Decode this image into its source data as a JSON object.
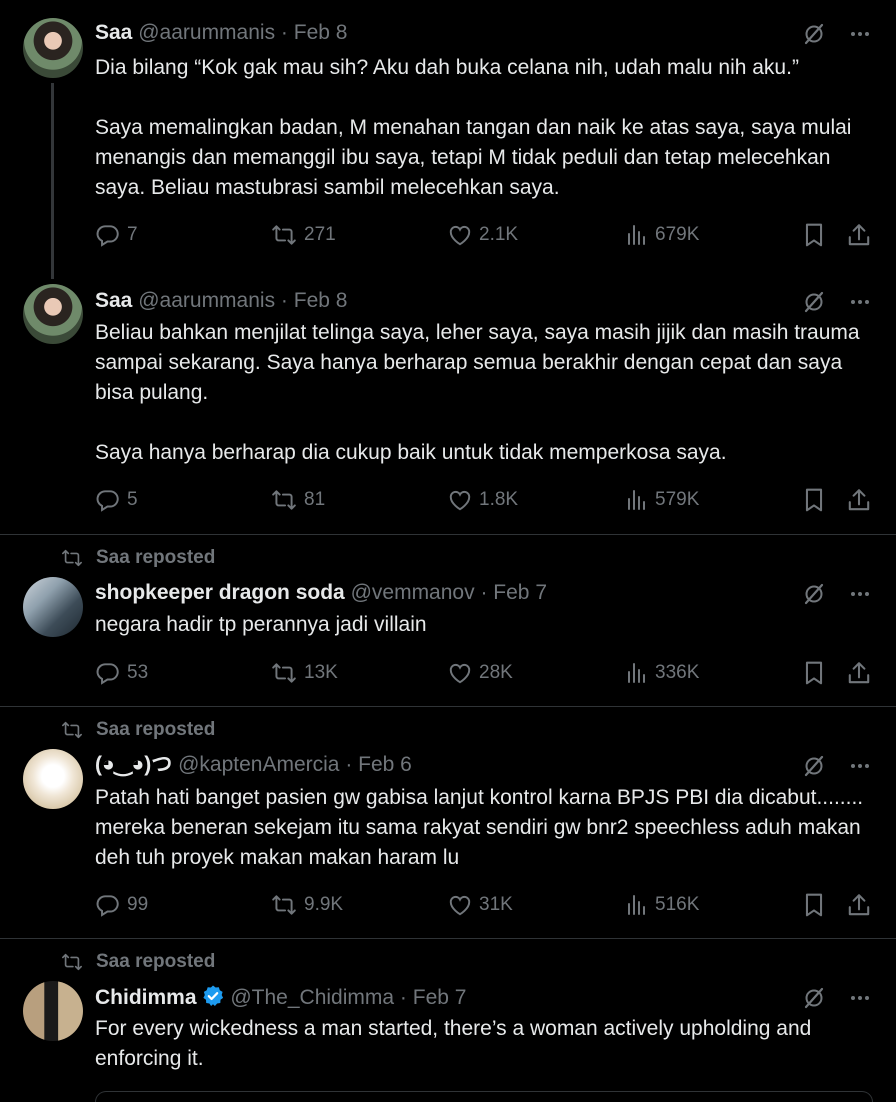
{
  "tweets": [
    {
      "reposted_by": "",
      "name": "Saa",
      "handle": "@aarummanis",
      "date": "Feb 8",
      "text": "Dia bilang “Kok gak mau sih? Aku dah buka celana nih, udah malu nih aku.”\n\nSaya memalingkan badan, M menahan tangan dan naik ke atas saya, saya mulai menangis dan memanggil ibu saya, tetapi M tidak peduli dan tetap melecehkan saya.  Beliau mastubrasi sambil melecehkan saya.",
      "replies": "7",
      "reposts": "271",
      "likes": "2.1K",
      "views": "679K"
    },
    {
      "reposted_by": "",
      "name": "Saa",
      "handle": "@aarummanis",
      "date": "Feb 8",
      "text": "Beliau bahkan menjilat telinga saya, leher saya, saya masih jijik dan masih trauma sampai sekarang. Saya hanya berharap semua berakhir dengan cepat dan saya bisa pulang.\n\nSaya hanya berharap dia cukup baik untuk tidak memperkosa saya.",
      "replies": "5",
      "reposts": "81",
      "likes": "1.8K",
      "views": "579K"
    },
    {
      "reposted_by": "Saa reposted",
      "name": "shopkeeper dragon soda",
      "handle": "@vemmanov",
      "date": "Feb 7",
      "text": "negara hadir tp perannya jadi villain",
      "replies": "53",
      "reposts": "13K",
      "likes": "28K",
      "views": "336K"
    },
    {
      "reposted_by": "Saa reposted",
      "name": "(◕‿◕)つ",
      "handle": "@kaptenAmercia",
      "date": "Feb 6",
      "text": "Patah hati banget pasien gw gabisa lanjut kontrol karna BPJS PBI dia dicabut........ mereka beneran sekejam itu sama rakyat sendiri gw bnr2 speechless aduh makan deh tuh proyek makan makan haram lu",
      "replies": "99",
      "reposts": "9.9K",
      "likes": "31K",
      "views": "516K"
    },
    {
      "reposted_by": "Saa reposted",
      "name": "Chidimma",
      "handle": "@The_Chidimma",
      "date": "Feb 7",
      "text": "For every wickedness a man started, there’s a woman actively upholding and enforcing it.",
      "verified": true
    }
  ],
  "icons": {
    "reply": "reply-icon",
    "repost": "repost-icon",
    "like": "heart-icon",
    "views": "views-icon",
    "bookmark": "bookmark-icon",
    "share": "share-icon",
    "grok": "grok-icon",
    "more": "more-icon",
    "verified": "verified-badge-icon"
  },
  "colors": {
    "background": "#000000",
    "text": "#e7e9ea",
    "muted": "#71767b",
    "verified": "#1d9bf0"
  }
}
